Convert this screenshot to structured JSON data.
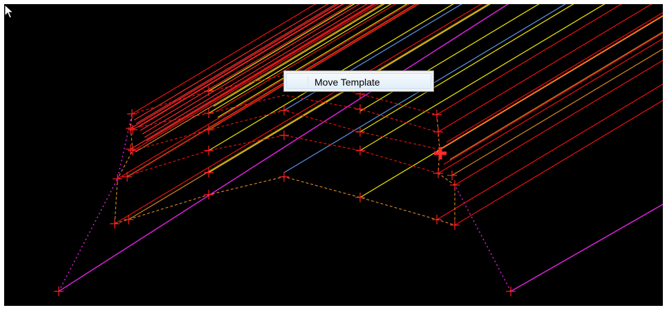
{
  "context_menu": {
    "items": [
      {
        "label": "Move Template"
      }
    ]
  },
  "colors": {
    "background": "#000000",
    "red": "#e01010",
    "bright_red": "#ff2a2a",
    "yellow": "#e8e000",
    "orange": "#d28020",
    "blue": "#5a8fe0",
    "magenta": "#d020d0",
    "point_marker": "#ff2020"
  },
  "icons": {
    "cursor": "arrow-cursor-icon",
    "point": "crosshair-point-icon",
    "active_point": "active-point-marker-icon"
  }
}
